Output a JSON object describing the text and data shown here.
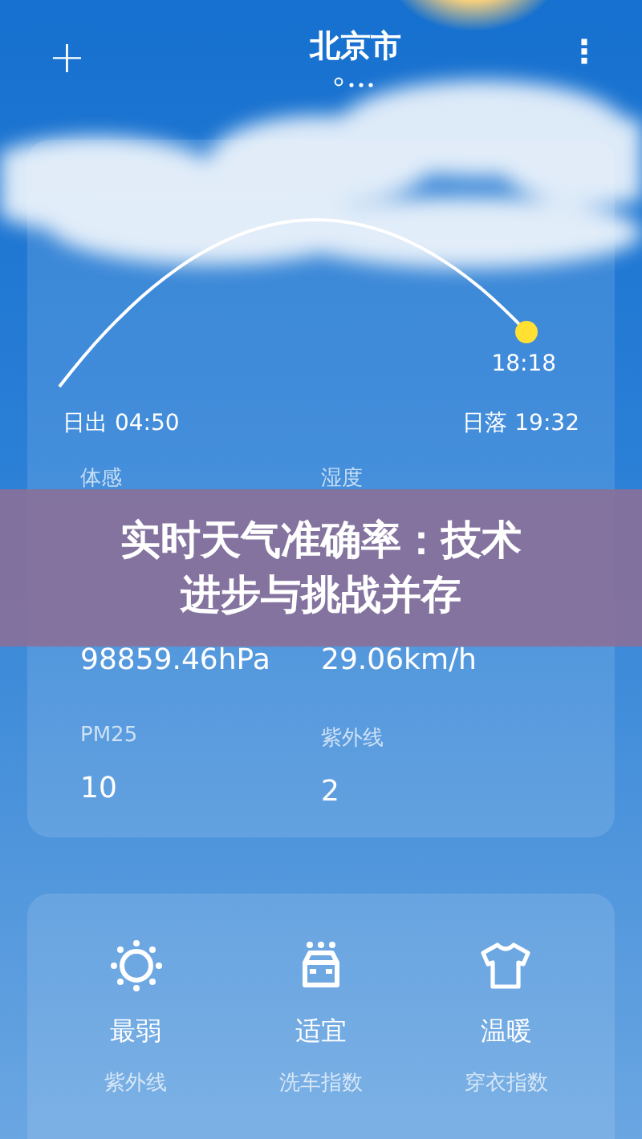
{
  "header": {
    "add": "+",
    "city": "北京市",
    "more": "⋮"
  },
  "sun": {
    "current_time": "18:18",
    "sunrise": "日出 04:50",
    "sunset": "日落 19:32"
  },
  "details": [
    {
      "label": "体感"
    },
    {
      "label": "湿度"
    },
    {
      "value": "98859.46hPa"
    },
    {
      "value": "29.06km/h"
    },
    {
      "label": "PM25",
      "value": "10"
    },
    {
      "label": "紫外线",
      "value": "2"
    }
  ],
  "indices": [
    {
      "kind": "sun",
      "value": "最弱",
      "name": "紫外线"
    },
    {
      "kind": "car",
      "value": "适宜",
      "name": "洗车指数"
    },
    {
      "kind": "shirt",
      "value": "温暖",
      "name": "穿衣指数"
    }
  ],
  "banner": {
    "lines": [
      "实时天气准确率：技术",
      "进步与挑战并存"
    ]
  }
}
